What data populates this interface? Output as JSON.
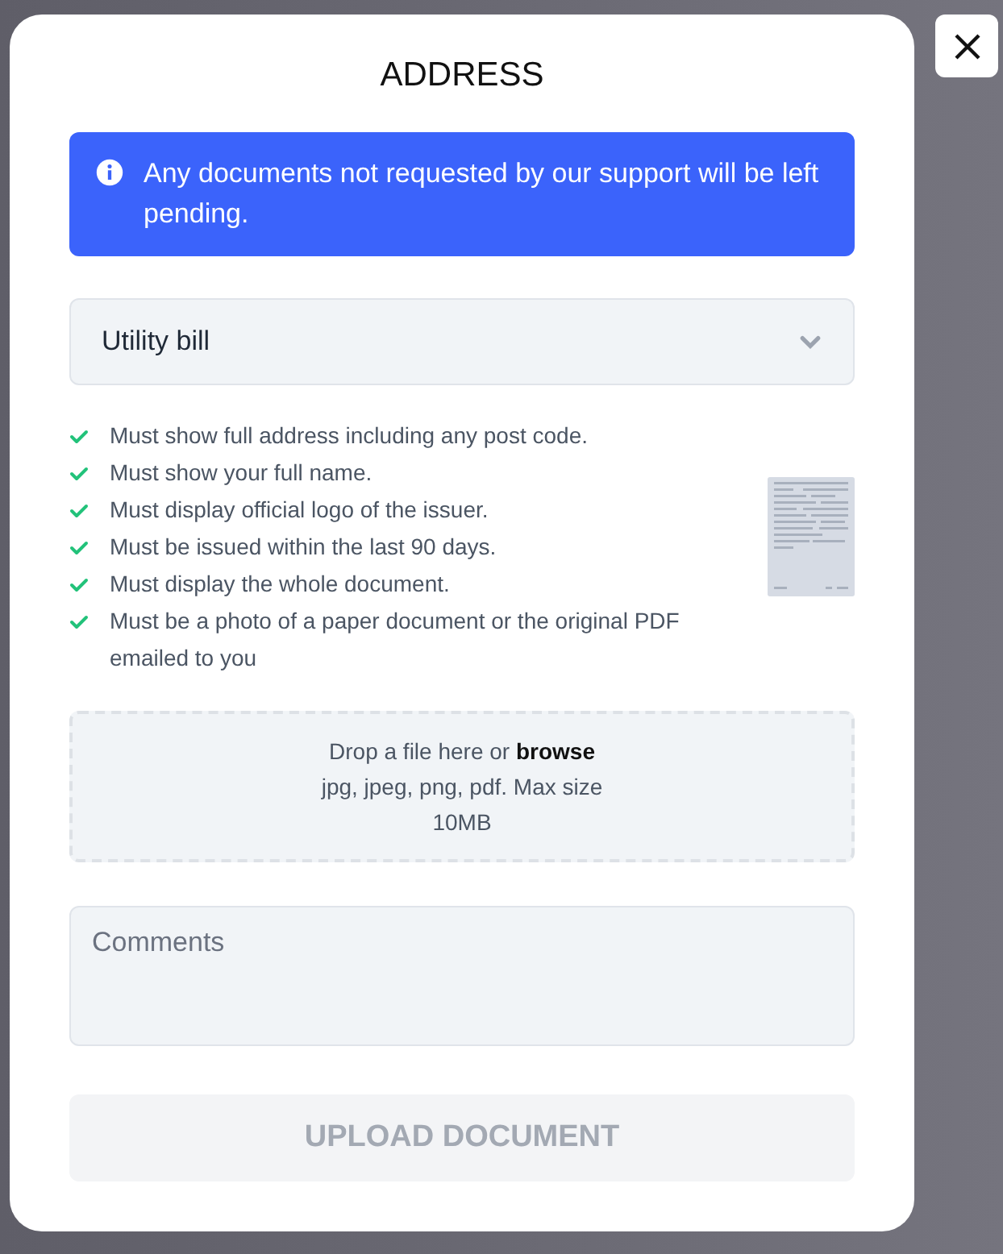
{
  "dialog": {
    "title": "ADDRESS"
  },
  "alert": {
    "text": "Any documents not requested by our support will be left pending."
  },
  "document_type": {
    "value": "Utility bill"
  },
  "requirements": [
    "Must show full address including any post code.",
    "Must show your full name.",
    "Must display official logo of the issuer.",
    "Must be issued within the last 90 days.",
    "Must display the whole document.",
    "Must be a photo of a paper document or the original PDF emailed to you"
  ],
  "dropzone": {
    "text": "Drop a file here or **browse**",
    "hint": "jpg, jpeg, png, pdf. Max size 10MB"
  },
  "comments": {
    "placeholder": "Comments"
  },
  "upload_button": {
    "label": "UPLOAD DOCUMENT",
    "disabled": true
  }
}
